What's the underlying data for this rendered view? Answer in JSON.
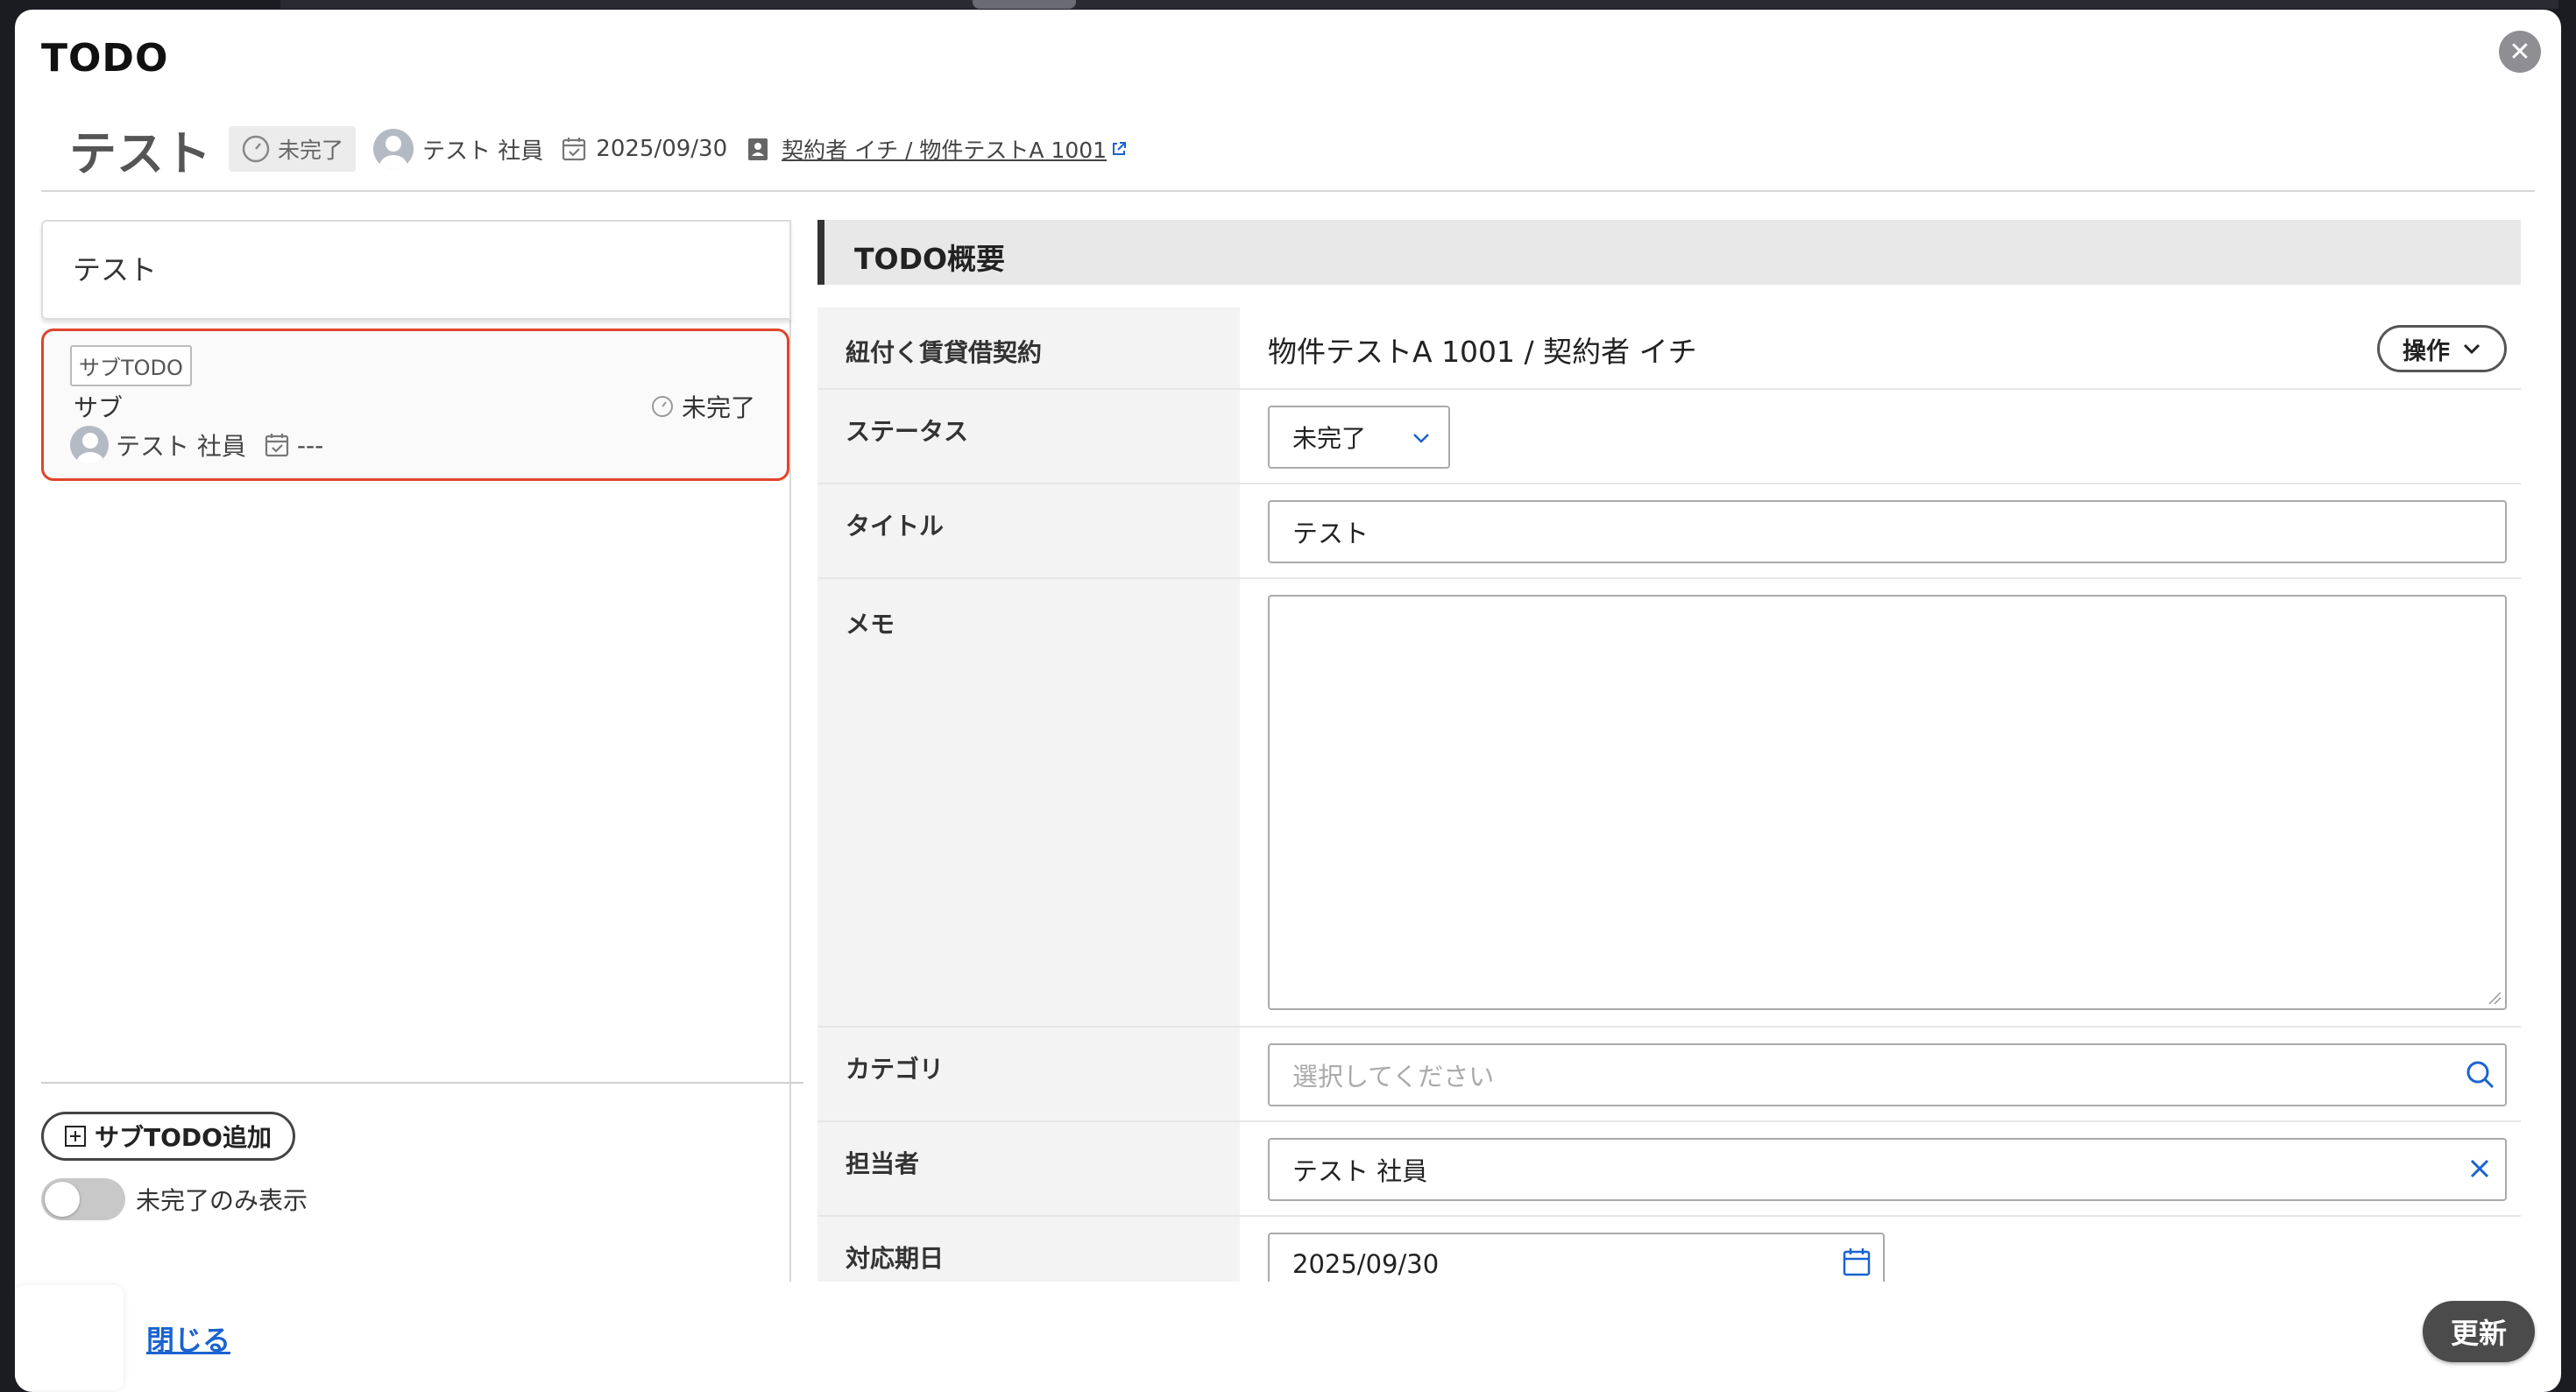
{
  "modal": {
    "title": "TODO",
    "close_icon": "close-icon"
  },
  "header": {
    "todo_title": "テスト",
    "status": "未完了",
    "assignee": "テスト 社員",
    "due_date": "2025/09/30",
    "contract_link": "契約者 イチ / 物件テストA 1001"
  },
  "left": {
    "parent_item": "テスト",
    "sub_item": {
      "badge": "サブTODO",
      "title": "サブ",
      "status": "未完了",
      "assignee": "テスト 社員",
      "due": "---"
    },
    "add_sub_label": "サブTODO追加",
    "toggle_label": "未完了のみ表示"
  },
  "form": {
    "section_title": "TODO概要",
    "contract": {
      "label": "紐付く賃貸借契約",
      "value": "物件テストA 1001 / 契約者 イチ",
      "op_label": "操作"
    },
    "status": {
      "label": "ステータス",
      "value": "未完了"
    },
    "title": {
      "label": "タイトル",
      "value": "テスト"
    },
    "memo": {
      "label": "メモ",
      "value": ""
    },
    "category": {
      "label": "カテゴリ",
      "placeholder": "選択してください"
    },
    "assignee": {
      "label": "担当者",
      "value": "テスト 社員"
    },
    "due": {
      "label": "対応期日",
      "value": "2025/09/30"
    }
  },
  "footer": {
    "close_label": "閉じる",
    "update_label": "更新"
  },
  "colors": {
    "highlight": "#e0432b",
    "link": "#1a63d1",
    "primary_button": "#4b4b4b"
  }
}
